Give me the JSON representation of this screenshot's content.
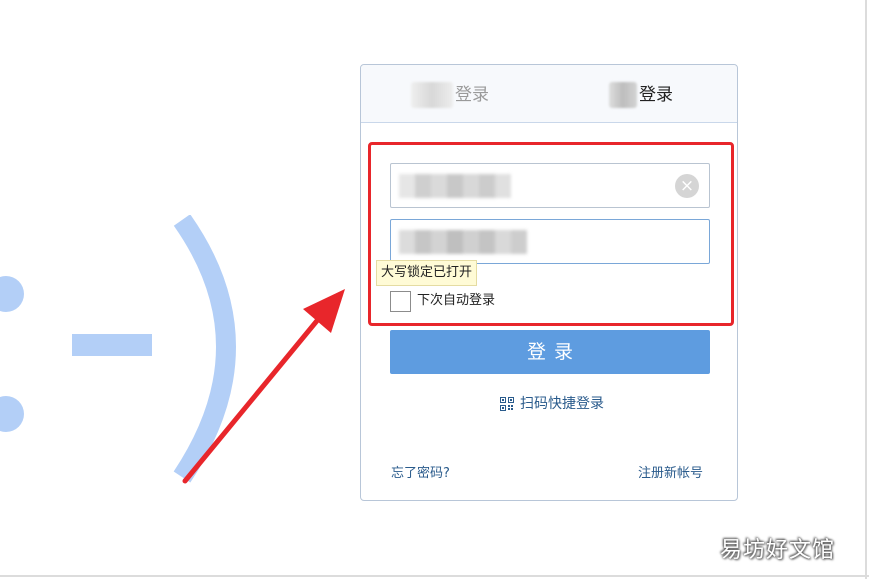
{
  "tabs": [
    {
      "label": "登录"
    },
    {
      "label": "登录"
    }
  ],
  "form": {
    "account_value": "",
    "password_value": "",
    "clear_glyph": "×",
    "capslock_tip": "大写锁定已打开",
    "remember_label": "下次自动登录",
    "remember_checked": false,
    "login_button": "登录"
  },
  "links": {
    "qr_login": "扫码快捷登录",
    "forgot_password": "忘了密码?",
    "register": "注册新帐号"
  },
  "watermark": "易坊好文馆",
  "colors": {
    "primary_button": "#5e9ce0",
    "link": "#2a5b8c",
    "highlight_box": "#e8262b",
    "arrow": "#e8262b",
    "smiley": "#b3cff7",
    "tooltip_bg": "#fffbd6"
  },
  "icons": {
    "clear": "close-circle-icon",
    "qr": "qr-code-icon"
  }
}
